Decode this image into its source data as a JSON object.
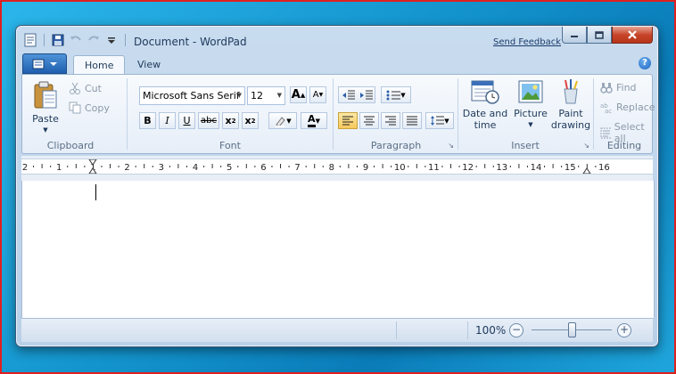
{
  "window": {
    "title": "Document - WordPad",
    "send_feedback": "Send Feedback"
  },
  "tabs": [
    "Home",
    "View"
  ],
  "clipboard": {
    "paste": "Paste",
    "cut": "Cut",
    "copy": "Copy",
    "group_label": "Clipboard"
  },
  "font": {
    "family": "Microsoft Sans Serif",
    "size": "12",
    "group_label": "Font"
  },
  "paragraph": {
    "group_label": "Paragraph"
  },
  "insert": {
    "date_time": "Date and time",
    "picture": "Picture",
    "paint_drawing": "Paint drawing",
    "group_label": "Insert"
  },
  "editing": {
    "find": "Find",
    "replace": "Replace",
    "select_all": "Select all",
    "group_label": "Editing"
  },
  "ruler": {
    "numbers": [
      "2",
      "1",
      "1",
      "2",
      "3",
      "4",
      "5",
      "6",
      "7",
      "8",
      "9",
      "10",
      "11",
      "12",
      "13",
      "14",
      "15",
      "16"
    ]
  },
  "status": {
    "zoom": "100%",
    "zoom_level": 1.0
  },
  "colors": {
    "accent": "#1f5fae",
    "close_button": "#c7462a",
    "font_color_underline": "#000000"
  }
}
